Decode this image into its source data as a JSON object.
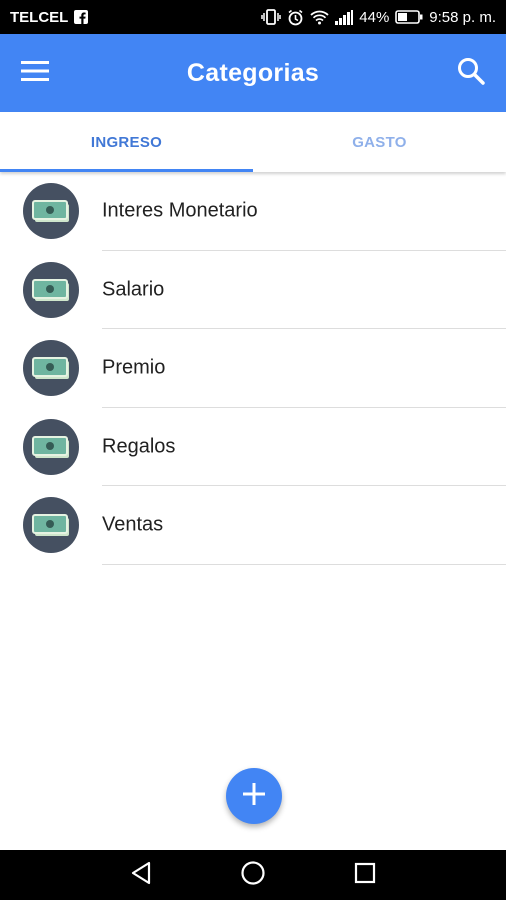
{
  "status_bar": {
    "carrier": "TELCEL",
    "battery_percent": "44%",
    "time": "9:58 p. m.",
    "icons": [
      "facebook-icon",
      "vibrate-icon",
      "alarm-icon",
      "wifi-icon",
      "signal-icon",
      "battery-icon"
    ]
  },
  "app_bar": {
    "title": "Categorias",
    "background_color": "#4285f4",
    "menu_icon": "menu-icon",
    "search_icon": "search-icon"
  },
  "tabs": [
    {
      "label": "INGRESO",
      "active": true
    },
    {
      "label": "GASTO",
      "active": false
    }
  ],
  "categories": [
    {
      "label": "Interes Monetario",
      "icon": "money-icon"
    },
    {
      "label": "Salario",
      "icon": "money-icon"
    },
    {
      "label": "Premio",
      "icon": "money-icon"
    },
    {
      "label": "Regalos",
      "icon": "money-icon"
    },
    {
      "label": "Ventas",
      "icon": "money-icon"
    }
  ],
  "fab": {
    "icon": "plus-icon"
  },
  "nav_bar": {
    "buttons": [
      "back-icon",
      "home-icon",
      "recents-icon"
    ]
  }
}
